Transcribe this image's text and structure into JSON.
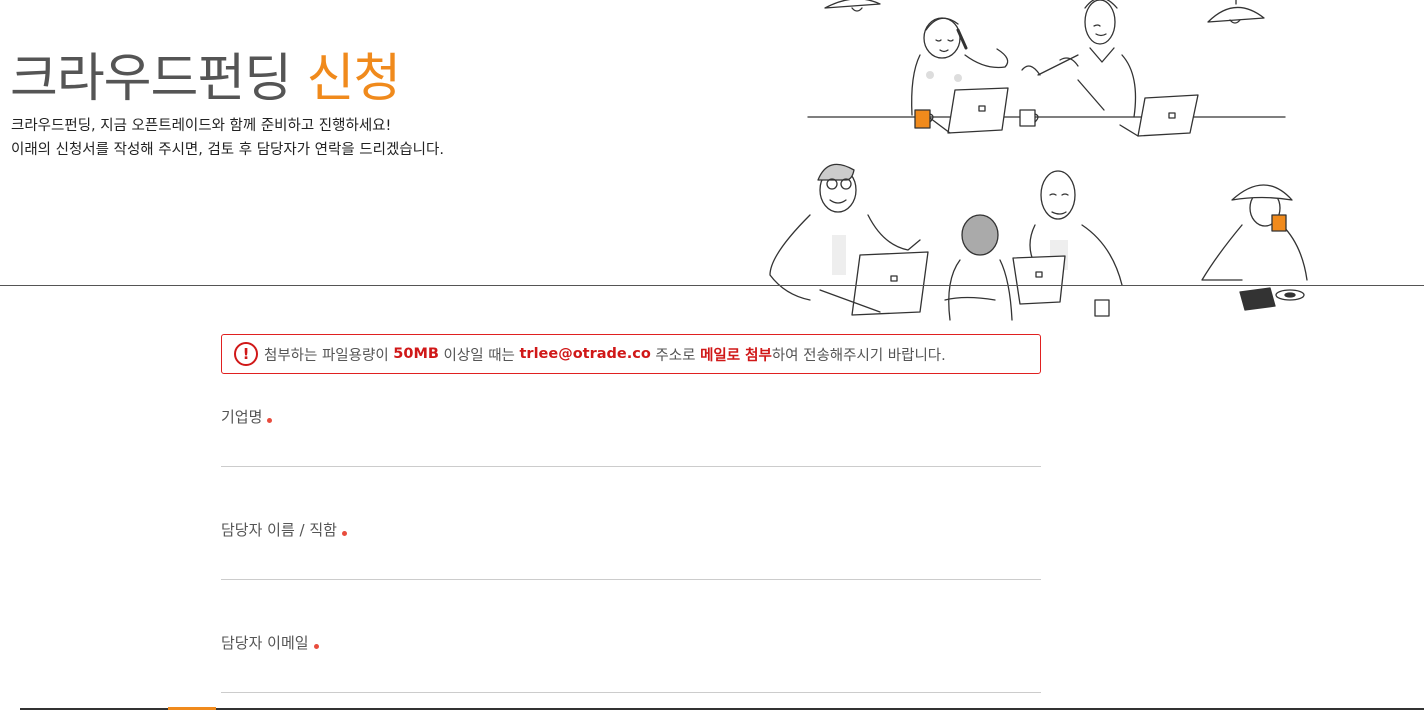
{
  "header": {
    "title_main": "크라우드펀딩",
    "title_accent": "신청",
    "intro_line1": "크라우드펀딩, 지금 오픈트레이드와 함께 준비하고 진행하세요!",
    "intro_line2": "이래의 신청서를 작성해 주시면, 검토 후 담당자가 연락을 드리겠습니다."
  },
  "notice": {
    "icon": "!",
    "part1": "첨부하는 파일용량이 ",
    "size": "50MB",
    "part2": " 이상일 때는 ",
    "email": "trlee@otrade.co",
    "part3": " 주소로 ",
    "action": "메일로 첨부",
    "part4": "하여 전송해주시기 바랍니다."
  },
  "form": {
    "company_label": "기업명",
    "company_value": "",
    "manager_label": "담당자 이름 / 직함",
    "manager_value": "",
    "email_label": "담당자 이메일",
    "email_value": ""
  },
  "colors": {
    "accent": "#f08a1c",
    "alert": "#d01818",
    "required": "#e84c3d"
  }
}
